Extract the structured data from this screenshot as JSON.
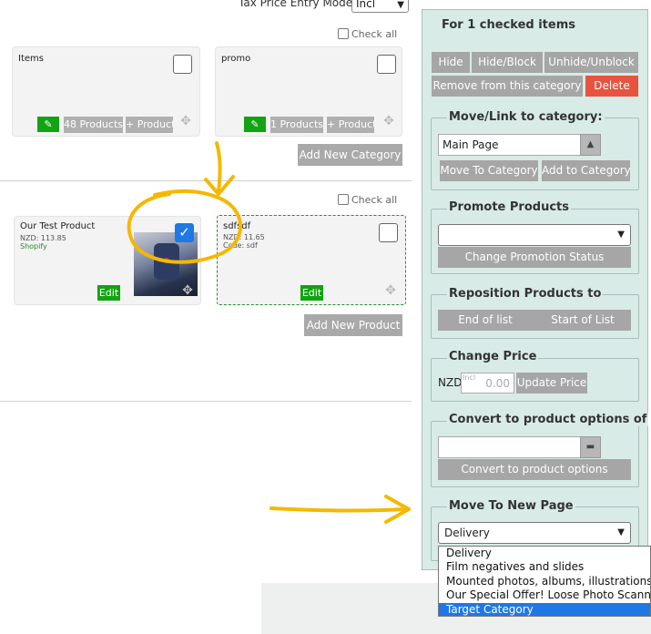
{
  "header": {
    "tax_label": "Tax Price Entry Mode:",
    "tax_value": "Incl"
  },
  "categories": {
    "check_all": "Check all",
    "items": [
      {
        "title": "Items",
        "products_label": "48 Products",
        "add_label": "+ Product"
      },
      {
        "title": "promo",
        "products_label": "1 Products",
        "add_label": "+ Product"
      }
    ],
    "add_new": "Add New Category"
  },
  "products": {
    "check_all": "Check all",
    "items": [
      {
        "name": "Our Test Product",
        "price": "NZD: 113.85",
        "vendor": "Shopify",
        "edit": "Edit",
        "checked": true
      },
      {
        "name": "sdfsdf",
        "price": "NZD: 11.65",
        "vendor": "Code: sdf",
        "edit": "Edit",
        "checked": false
      }
    ],
    "add_new": "Add New Product"
  },
  "panel": {
    "title": "For 1 checked items",
    "visibility": {
      "hide": "Hide",
      "hide_block": "Hide/Block",
      "unhide": "Unhide/Unblock",
      "remove": "Remove from this category",
      "delete": "Delete"
    },
    "move_link": {
      "legend": "Move/Link to category:",
      "value": "Main Page",
      "move": "Move To Category",
      "add": "Add to Category"
    },
    "promote": {
      "legend": "Promote Products",
      "value": "",
      "button": "Change Promotion Status"
    },
    "reposition": {
      "legend": "Reposition Products to",
      "end": "End of list",
      "start": "Start of List"
    },
    "price": {
      "legend": "Change Price",
      "currency": "NZD",
      "placeholder": "0.00",
      "incl": "Incl",
      "button": "Update Price"
    },
    "convert": {
      "legend": "Convert to product options of",
      "value": "",
      "button": "Convert to product options"
    },
    "new_page": {
      "legend": "Move To New Page",
      "value": "Delivery",
      "options": [
        "Delivery",
        "Film negatives and slides",
        "Mounted photos, albums, illustrations & do",
        "Our Special Offer! Loose Photo Scanning",
        "Target Category"
      ],
      "selected_index": 4
    }
  },
  "colors": {
    "annotation": "#f5b800",
    "green": "#12a312",
    "red": "#e8533f",
    "panel": "#d8ebe7",
    "highlight": "#1e78e6"
  }
}
